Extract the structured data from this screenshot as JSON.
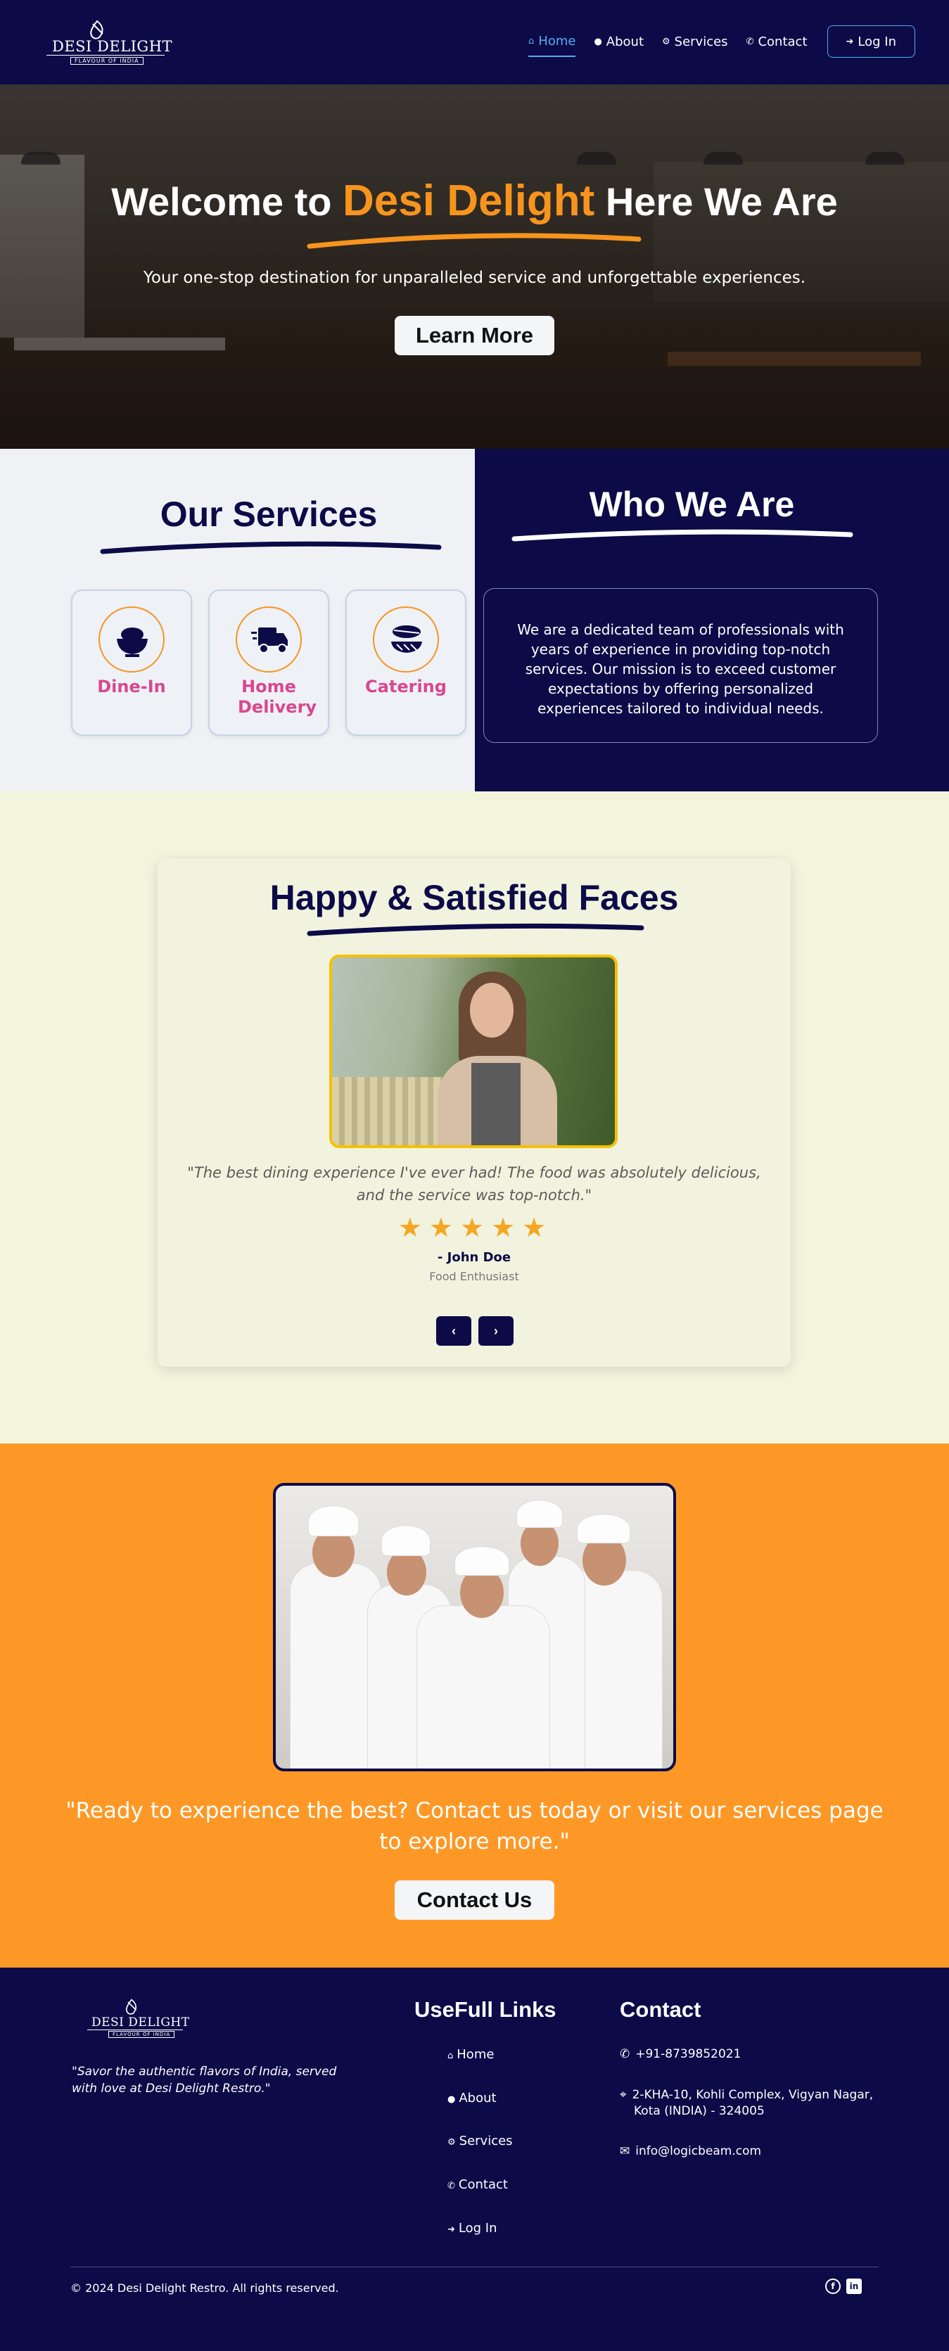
{
  "brand": {
    "name": "DESI DELIGHT",
    "tagline": "FLAVOUR OF INDIA"
  },
  "nav": {
    "items": [
      {
        "label": "Home",
        "icon": "home-icon",
        "active": true
      },
      {
        "label": "About",
        "icon": "info-icon"
      },
      {
        "label": "Services",
        "icon": "gears-icon"
      },
      {
        "label": "Contact",
        "icon": "phone-icon"
      }
    ],
    "login": {
      "label": "Log In",
      "icon": "login-icon"
    }
  },
  "hero": {
    "title_pre": "Welcome to ",
    "title_accent": "Desi Delight",
    "title_post": " Here We Are",
    "subtitle": "Your one-stop destination for unparalleled service and unforgettable experiences.",
    "button": "Learn More"
  },
  "services": {
    "title": "Our Services",
    "items": [
      {
        "label": "Dine-In",
        "icon": "bowl-icon"
      },
      {
        "label": "Home Delivery",
        "icon": "delivery-truck-icon"
      },
      {
        "label": "Catering",
        "icon": "catering-plate-icon"
      }
    ]
  },
  "about": {
    "title": "Who We Are",
    "text": "We are a dedicated team of professionals with years of experience in providing top-notch services. Our mission is to exceed customer expectations by offering personalized experiences tailored to individual needs."
  },
  "testimonials": {
    "title": "Happy & Satisfied Faces",
    "quote": "\"The best dining experience I've ever had! The food was absolutely delicious, and the service was top-notch.\"",
    "rating": 5,
    "author": "- John Doe",
    "role": "Food Enthusiast",
    "prev": "‹",
    "next": "›"
  },
  "cta": {
    "message": "\"Ready to experience the best? Contact us today or visit our services page to explore more.\"",
    "button": "Contact Us"
  },
  "footer": {
    "motto": "\"Savor the authentic flavors of India, served with love at Desi Delight Restro.\"",
    "links_title": "UseFull Links",
    "links": [
      "Home",
      "About",
      "Services",
      "Contact",
      "Log In"
    ],
    "contact_title": "Contact",
    "phone": "+91-8739852021",
    "address": "2-KHA-10, Kohli Complex, Vigyan Nagar, Kota (INDIA) - 324005",
    "email": "info@logicbeam.com",
    "copyright": "© 2024 Desi Delight Restro. All rights reserved."
  },
  "colors": {
    "navy": "#0c0b48",
    "orange": "#f7941d",
    "pink": "#d9478f",
    "link_blue": "#58aaf0",
    "cream": "#f3f4dc"
  }
}
